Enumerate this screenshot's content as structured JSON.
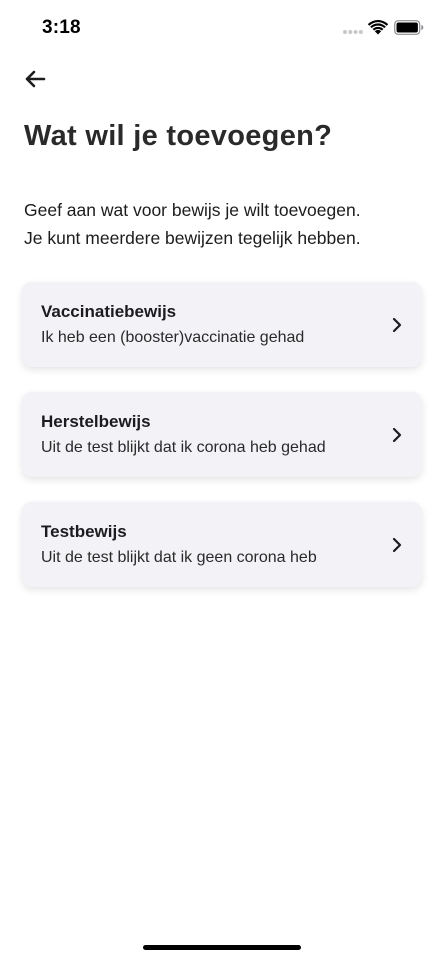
{
  "status_bar": {
    "time": "3:18",
    "icons": [
      "signal-icon",
      "wifi-icon",
      "battery-icon"
    ]
  },
  "header": {
    "back_icon": "arrow-left-icon"
  },
  "page": {
    "title": "Wat wil je toevoegen?",
    "description_line1": "Geef aan wat voor bewijs je wilt toevoegen.",
    "description_line2": "Je kunt meerdere bewijzen tegelijk hebben."
  },
  "options": [
    {
      "title": "Vaccinatiebewijs",
      "subtitle": "Ik heb een (booster)vaccinatie gehad"
    },
    {
      "title": "Herstelbewijs",
      "subtitle": "Uit de test blijkt dat ik corona heb gehad"
    },
    {
      "title": "Testbewijs",
      "subtitle": "Uit de test blijkt dat ik geen corona heb"
    }
  ],
  "colors": {
    "background": "#ffffff",
    "card_background": "#f3f3f7",
    "text": "#1c1c1e"
  }
}
